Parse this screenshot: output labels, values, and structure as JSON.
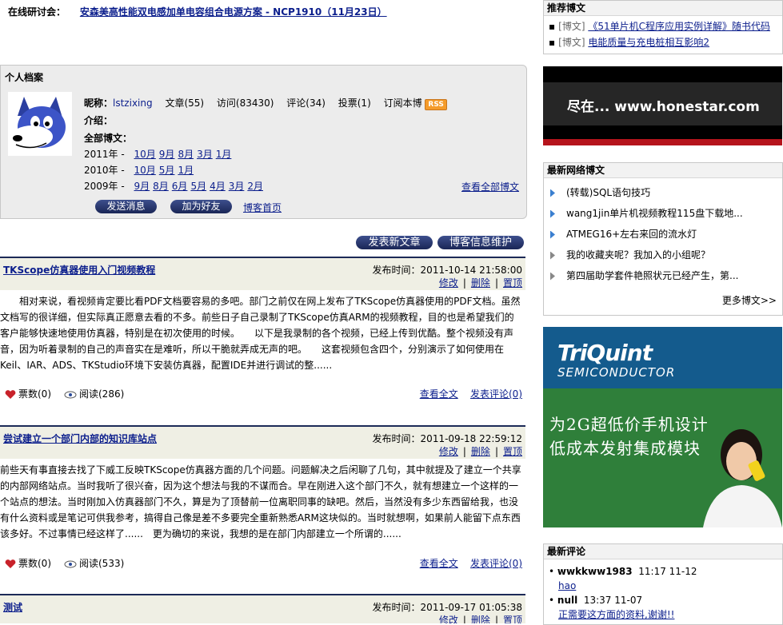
{
  "seminar": {
    "label": "在线研讨会：",
    "link": "安森美高性能双电感加单电容组合电源方案 - NCP1910（11月23日）"
  },
  "profile": {
    "title": "个人档案",
    "nick_label": "昵称：",
    "nick": "lstzixing",
    "articles": "文章(55)",
    "visits": "访问(83430)",
    "comments": "评论(34)",
    "votes": "投票(1)",
    "subscribe": "订阅本博",
    "rss": "RSS",
    "intro_label": "介绍：",
    "all_posts_label": "全部博文：",
    "archive": [
      {
        "year": "2011年 -",
        "months": [
          "10月",
          "9月",
          "8月",
          "3月",
          "1月"
        ]
      },
      {
        "year": "2010年 -",
        "months": [
          "10月",
          "5月",
          "1月"
        ]
      },
      {
        "year": "2009年 -",
        "months": [
          "9月",
          "8月",
          "6月",
          "5月",
          "4月",
          "3月",
          "2月"
        ]
      }
    ],
    "view_all": "查看全部博文",
    "send_message": "发送消息",
    "add_friend": "加为好友",
    "blog_home": "博客首页"
  },
  "toolbar": {
    "new_post": "发表新文章",
    "blog_maintenance": "博客信息维护"
  },
  "posts": [
    {
      "title": "TKScope仿真器使用入门视频教程",
      "date": "发布时间：2011-10-14 21:58:00",
      "edit": "修改",
      "delete": "删除",
      "top": "置顶",
      "body": "　　相对来说，看视频肯定要比看PDF文档要容易的多吧。部门之前仅在网上发布了TKScope仿真器使用的PDF文档。虽然文档写的很详细，但实际真正愿意去看的不多。前些日子自己录制了TKScope仿真ARM的视频教程，目的也是希望我们的客户能够快速地使用仿真器，特别是在初次使用的时候。　　以下是我录制的各个视频，已经上传到优酷。整个视频没有声音，因为听着录制的自己的声音实在是难听，所以干脆就弄成无声的吧。　　这套视频包含四个，分别演示了如何使用在Keil、IAR、ADS、TKStudio环境下安装仿真器，配置IDE并进行调试的整......",
      "votes": "票数(0)",
      "reads": "阅读(286)",
      "read_more": "查看全文",
      "comment": "发表评论(0)"
    },
    {
      "title": "尝试建立一个部门内部的知识库站点",
      "date": "发布时间：2011-09-18 22:59:12",
      "edit": "修改",
      "delete": "删除",
      "top": "置顶",
      "body": "前些天有事直接去找了下威工反映TKScope仿真器方面的几个问题。问题解决之后闲聊了几句，其中就提及了建立一个共享的内部网络站点。当时我听了很兴奋，因为这个想法与我的不谋而合。早在刚进入这个部门不久，就有想建立一个这样的一个站点的想法。当时刚加入仿真器部门不久，算是为了顶替前一位离职同事的缺吧。然后，当然没有多少东西留给我，也没有什么资料或是笔记可供我参考，搞得自己像是差不多要完全重新熟悉ARM这块似的。当时就想啊，如果前人能留下点东西该多好。不过事情已经这样了......　更为确切的来说，我想的是在部门内部建立一个所谓的......",
      "votes": "票数(0)",
      "reads": "阅读(533)",
      "read_more": "查看全文",
      "comment": "发表评论(0)"
    },
    {
      "title": "测试",
      "date": "发布时间：2011-09-17 01:05:38",
      "edit": "修改",
      "delete": "删除",
      "top": "置顶"
    }
  ],
  "recommended": {
    "title": "推荐博文",
    "items": [
      {
        "tag": "[博文]",
        "text": "《51单片机C程序应用实例详解》随书代码"
      },
      {
        "tag": "[博文]",
        "text": "电能质量与充电桩相互影响2"
      }
    ]
  },
  "ad1": {
    "text": "尽在... www.honestar.com"
  },
  "latest": {
    "title": "最新网络博文",
    "items": [
      "(转载)SQL语句技巧",
      "wang1jin单片机视频教程115盘下载地...",
      "ATMEG16+左右来回的流水灯",
      "我的收藏夹呢？我加入的小组呢？",
      "第四届助学套件艳照状元已经产生，第..."
    ],
    "more": "更多博文>>"
  },
  "ad2": {
    "logo": "TriQuint",
    "sub": "SEMICONDUCTOR",
    "line1": "为2G超低价手机设计",
    "line2": "低成本发射集成模块"
  },
  "recent_comments": {
    "title": "最新评论",
    "items": [
      {
        "user": "wwkkww1983",
        "time": "11:17 11-12",
        "text": "hao"
      },
      {
        "user": "null",
        "time": "13:37 11-07",
        "text": "正需要这方面的资料,谢谢!!"
      }
    ]
  },
  "colors": {
    "link": "#0b1e8c",
    "header_bar": "#1c2a57",
    "profile_bg": "#ececec",
    "post_head_bg": "#efefe4",
    "rss": "#f49b2a"
  }
}
